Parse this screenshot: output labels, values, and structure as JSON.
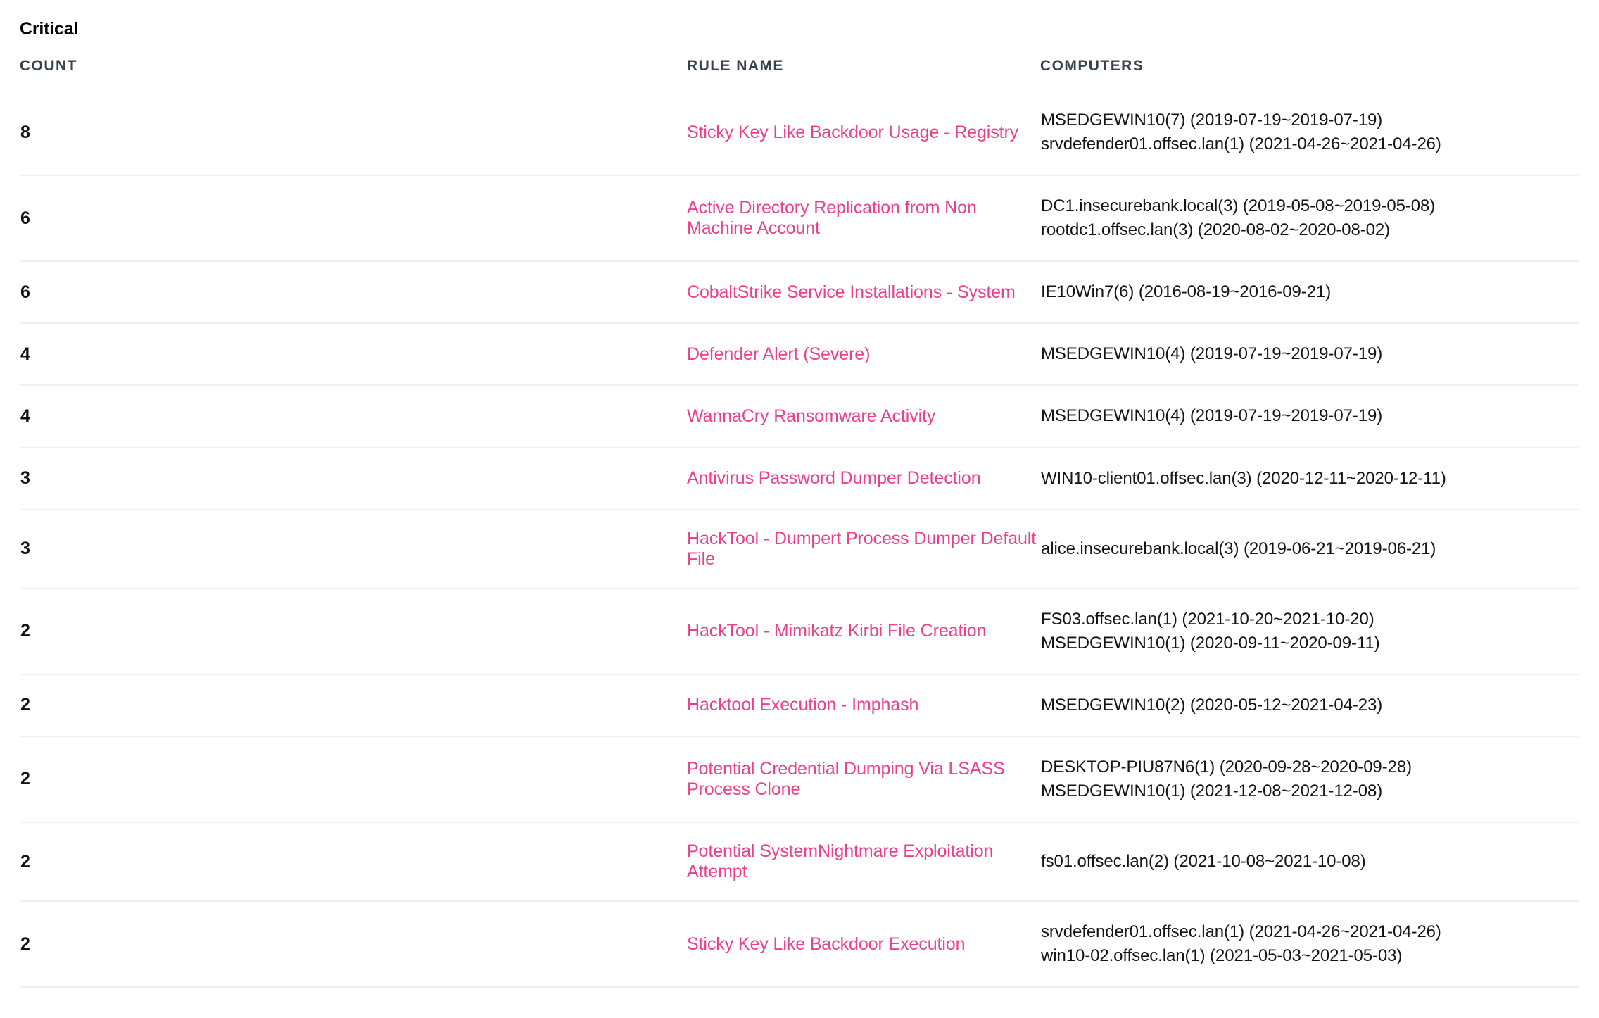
{
  "section": {
    "title": "Critical"
  },
  "table": {
    "headers": {
      "count": "COUNT",
      "rule_name": "RULE NAME",
      "computers": "COMPUTERS"
    },
    "accent_color": "#ed3f8c",
    "header_color": "#37414f",
    "border_color": "#f0f0f2",
    "rows": [
      {
        "count": "8",
        "rule_name": "Sticky Key Like Backdoor Usage - Registry",
        "computers": [
          "MSEDGEWIN10(7) (2019-07-19~2019-07-19)",
          "srvdefender01.offsec.lan(1) (2021-04-26~2021-04-26)"
        ]
      },
      {
        "count": "6",
        "rule_name": "Active Directory Replication from Non Machine Account",
        "computers": [
          "DC1.insecurebank.local(3) (2019-05-08~2019-05-08)",
          "rootdc1.offsec.lan(3) (2020-08-02~2020-08-02)"
        ]
      },
      {
        "count": "6",
        "rule_name": "CobaltStrike Service Installations - System",
        "computers": [
          "IE10Win7(6) (2016-08-19~2016-09-21)"
        ]
      },
      {
        "count": "4",
        "rule_name": "Defender Alert (Severe)",
        "computers": [
          "MSEDGEWIN10(4) (2019-07-19~2019-07-19)"
        ]
      },
      {
        "count": "4",
        "rule_name": "WannaCry Ransomware Activity",
        "computers": [
          "MSEDGEWIN10(4) (2019-07-19~2019-07-19)"
        ]
      },
      {
        "count": "3",
        "rule_name": "Antivirus Password Dumper Detection",
        "computers": [
          "WIN10-client01.offsec.lan(3) (2020-12-11~2020-12-11)"
        ]
      },
      {
        "count": "3",
        "rule_name": "HackTool - Dumpert Process Dumper Default File",
        "computers": [
          "alice.insecurebank.local(3) (2019-06-21~2019-06-21)"
        ]
      },
      {
        "count": "2",
        "rule_name": "HackTool - Mimikatz Kirbi File Creation",
        "computers": [
          "FS03.offsec.lan(1) (2021-10-20~2021-10-20)",
          "MSEDGEWIN10(1) (2020-09-11~2020-09-11)"
        ]
      },
      {
        "count": "2",
        "rule_name": "Hacktool Execution - Imphash",
        "computers": [
          "MSEDGEWIN10(2) (2020-05-12~2021-04-23)"
        ]
      },
      {
        "count": "2",
        "rule_name": "Potential Credential Dumping Via LSASS Process Clone",
        "computers": [
          "DESKTOP-PIU87N6(1) (2020-09-28~2020-09-28)",
          "MSEDGEWIN10(1) (2021-12-08~2021-12-08)"
        ]
      },
      {
        "count": "2",
        "rule_name": "Potential SystemNightmare Exploitation Attempt",
        "computers": [
          "fs01.offsec.lan(2) (2021-10-08~2021-10-08)"
        ]
      },
      {
        "count": "2",
        "rule_name": "Sticky Key Like Backdoor Execution",
        "computers": [
          "srvdefender01.offsec.lan(1) (2021-04-26~2021-04-26)",
          "win10-02.offsec.lan(1) (2021-05-03~2021-05-03)"
        ]
      }
    ]
  }
}
